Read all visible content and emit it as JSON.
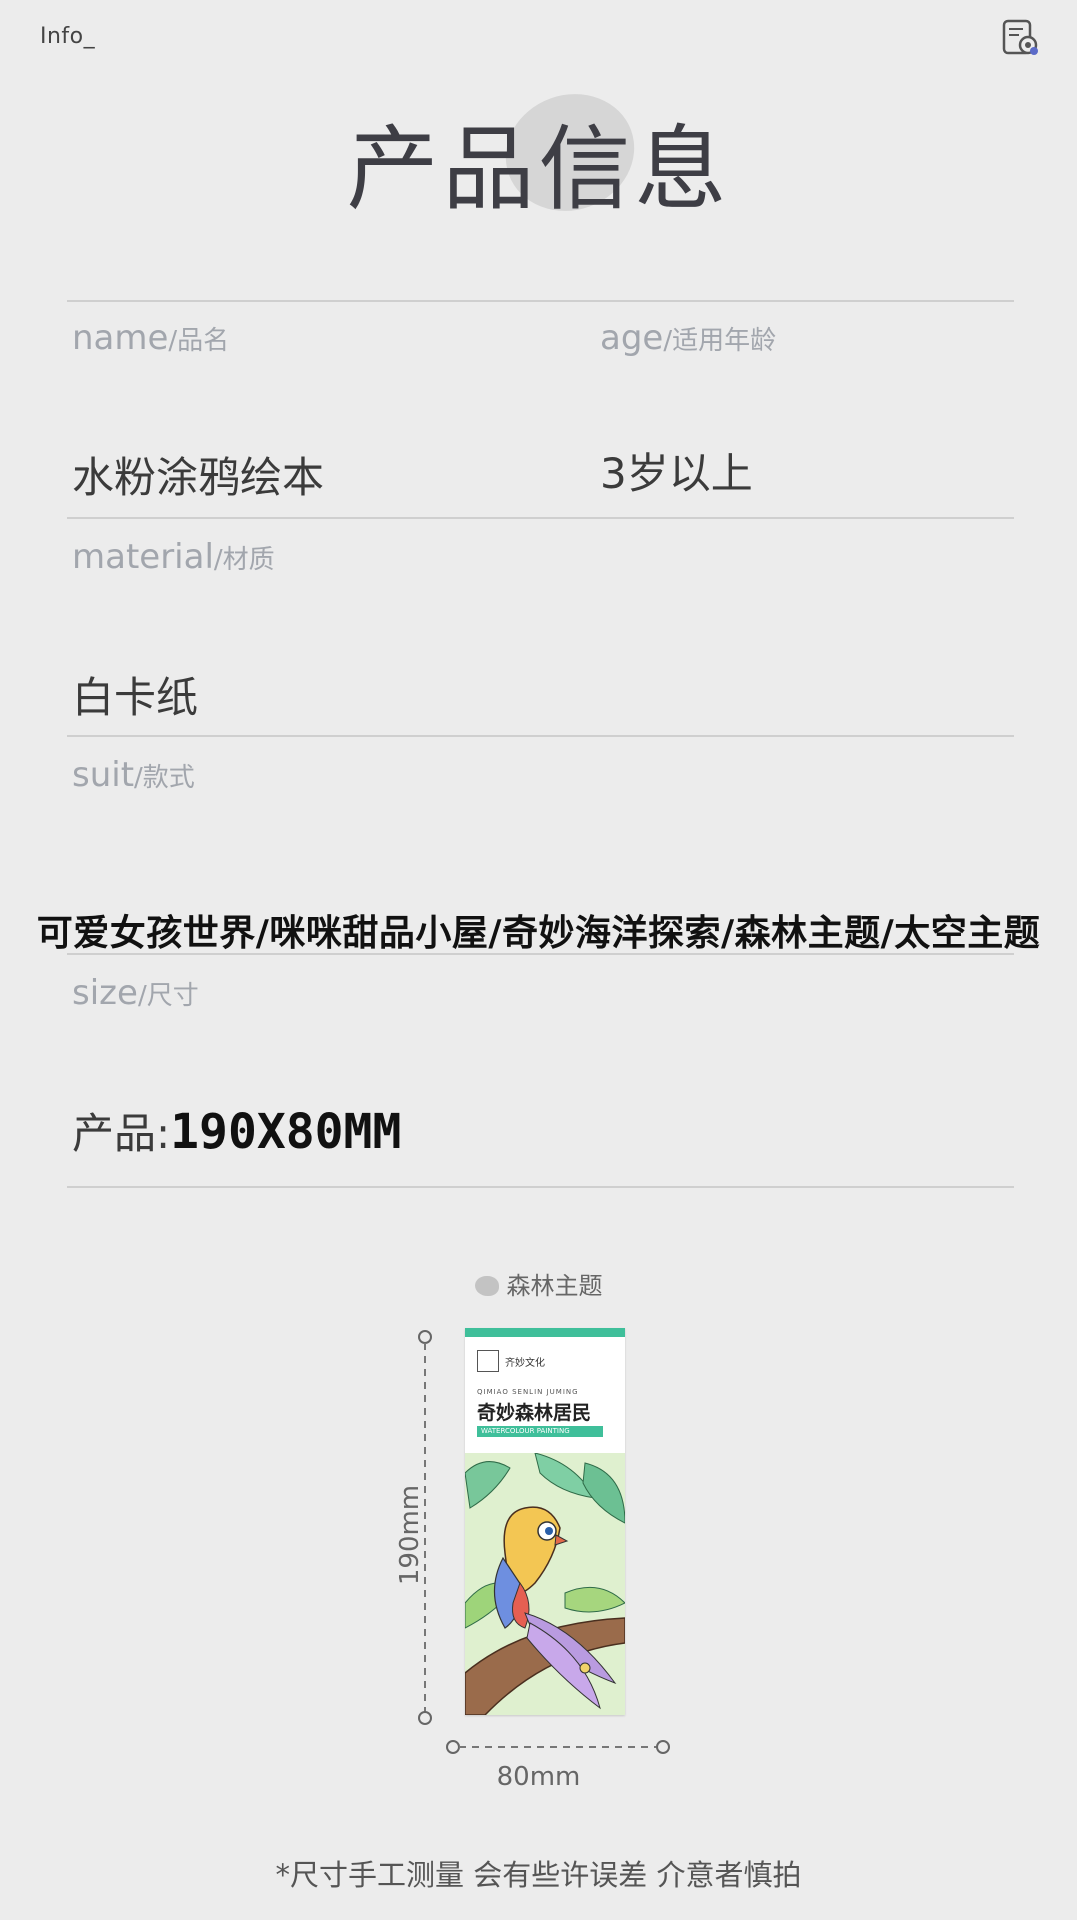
{
  "header": {
    "info_label": "Info_",
    "title": "产品信息"
  },
  "fields": {
    "name": {
      "label_en": "name",
      "label_cn": "/品名",
      "value": "水粉涂鸦绘本"
    },
    "age": {
      "label_en": "age",
      "label_cn": "/适用年龄",
      "value": "3岁以上"
    },
    "material": {
      "label_en": "material",
      "label_cn": "/材质",
      "value": "白卡纸"
    },
    "suit": {
      "label_en": "suit",
      "label_cn": "/款式",
      "value": "可爱女孩世界/咪咪甜品小屋/奇妙海洋探索/森林主题/太空主题"
    },
    "size": {
      "label_en": "size",
      "label_cn": "/尺寸",
      "prefix": "产品:",
      "value": "190X80MM"
    }
  },
  "figure": {
    "theme_label": "森林主题",
    "book": {
      "brand": "齐妙文化",
      "pinyin": "QIMIAO SENLIN JUMING",
      "title": "奇妙森林居民",
      "banner": "WATERCOLOUR PAINTING"
    },
    "height_label": "190mm",
    "width_label": "80mm"
  },
  "footnote": "*尺寸手工测量 会有些许误差 介意者慎拍",
  "colors": {
    "background": "#ececec",
    "accent_teal": "#3fbf9a",
    "label_gray": "#a2a6ad",
    "divider": "#cfcfcf"
  },
  "icons": {
    "settings": "settings-gear-icon"
  }
}
